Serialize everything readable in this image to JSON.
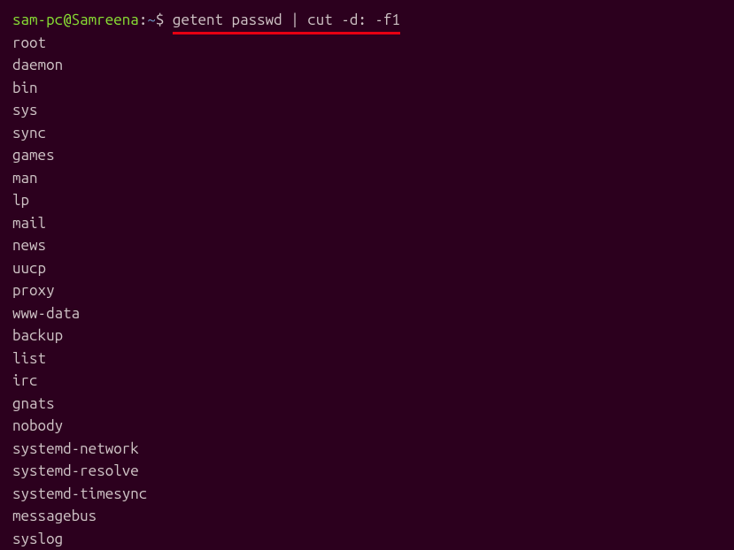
{
  "prompt": {
    "user_host": "sam-pc@Samreena",
    "sep1": ":",
    "path": "~",
    "dollar": "$ "
  },
  "command": "getent passwd | cut -d: -f1",
  "output_lines": [
    "root",
    "daemon",
    "bin",
    "sys",
    "sync",
    "games",
    "man",
    "lp",
    "mail",
    "news",
    "uucp",
    "proxy",
    "www-data",
    "backup",
    "list",
    "irc",
    "gnats",
    "nobody",
    "systemd-network",
    "systemd-resolve",
    "systemd-timesync",
    "messagebus",
    "syslog"
  ]
}
